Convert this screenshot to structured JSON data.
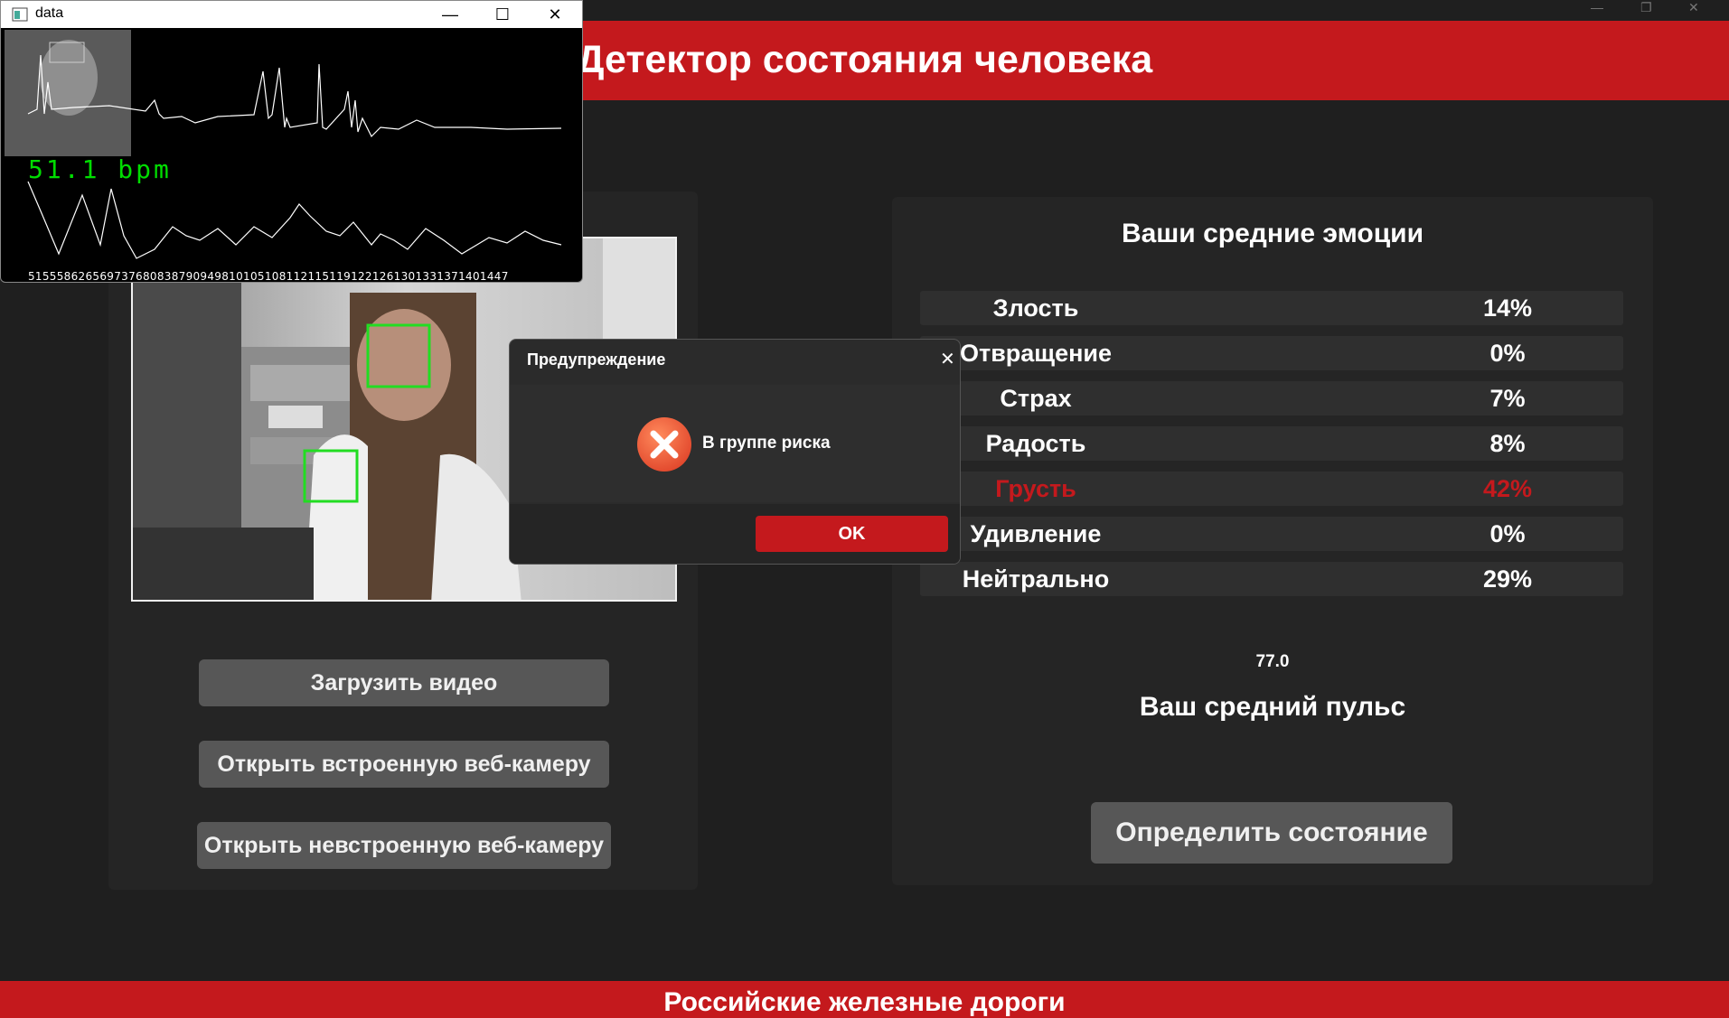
{
  "app": {
    "title": "Детектор состояния человека",
    "footer": "Российские железные дороги"
  },
  "left_buttons": {
    "load_video": "Загрузить видео",
    "open_builtin_cam": "Открыть встроенную веб-камеру",
    "open_external_cam": "Открыть невстроенную веб-камеру"
  },
  "emotions": {
    "title": "Ваши средние эмоции",
    "items": [
      {
        "name": "Злость",
        "value": "14%"
      },
      {
        "name": "Отвращение",
        "value": "0%"
      },
      {
        "name": "Страх",
        "value": "7%"
      },
      {
        "name": "Радость",
        "value": "8%"
      },
      {
        "name": "Грусть",
        "value": "42%"
      },
      {
        "name": "Удивление",
        "value": "0%"
      },
      {
        "name": "Нейтрально",
        "value": "29%"
      }
    ],
    "highlight_color": "#c4191d"
  },
  "pulse": {
    "value": "77.0",
    "title": "Ваш средний пульс"
  },
  "detect_button": "Определить состояние",
  "data_window": {
    "title": "data",
    "bpm": "51.1 bpm",
    "tick_labels": "5155586265697376808387909498101051081121151191221261301331371401447"
  },
  "dialog": {
    "title": "Предупреждение",
    "message": "В группе риска",
    "ok_label": "OK"
  },
  "colors": {
    "accent": "#c4191d",
    "background": "#1f1f1f",
    "panel": "#252525",
    "button": "#575757",
    "face_box": "#22dd22"
  }
}
